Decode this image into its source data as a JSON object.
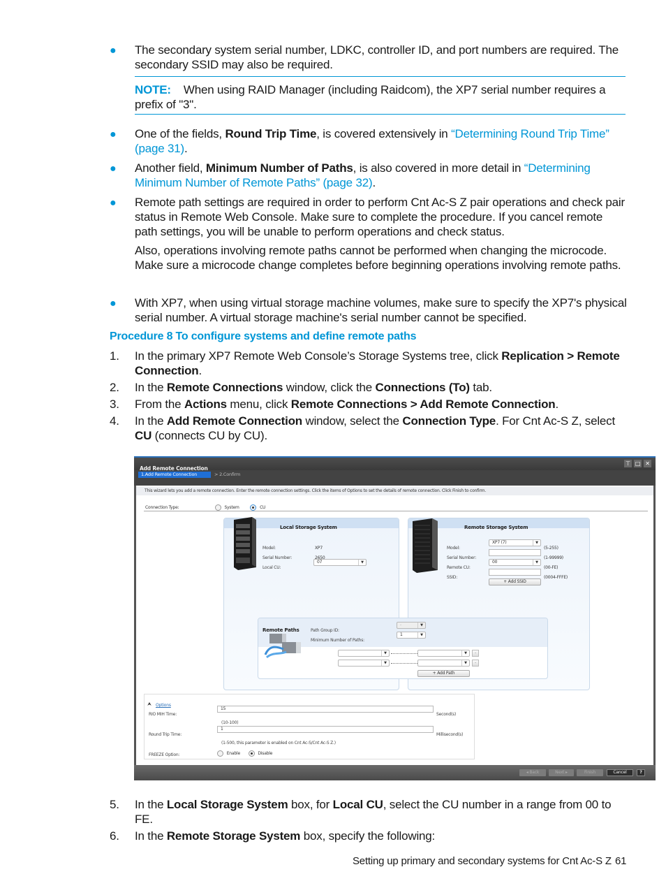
{
  "bullets": {
    "b1": {
      "text": "The secondary system serial number, LDKC, controller ID, and port numbers are required. The secondary SSID may also be required."
    },
    "note": {
      "label": "NOTE:",
      "text": "When using RAID Manager (including Raidcom), the XP7 serial number requires a prefix of \"3\"."
    },
    "b2": {
      "pre": "One of the fields, ",
      "bold": "Round Trip Time",
      "mid": ", is covered extensively in ",
      "link": "“Determining Round Trip Time” (page 31)",
      "post": "."
    },
    "b3": {
      "pre": "Another field, ",
      "bold": "Minimum Number of Paths",
      "mid": ", is also covered in more detail in ",
      "link": "“Determining Minimum Number of Remote Paths” (page 32)",
      "post": "."
    },
    "b4": {
      "text": "Remote path settings are required in order to perform Cnt Ac-S Z pair operations and check pair status in Remote Web Console. Make sure to complete the procedure. If you cancel remote path settings, you will be unable to perform operations and check status.",
      "text2": "Also, operations involving remote paths cannot be performed when changing the microcode. Make sure a microcode change completes before beginning operations involving remote paths."
    },
    "b5": {
      "text": "With XP7, when using virtual storage machine volumes, make sure to specify the XP7's physical serial number. A virtual storage machine's serial number cannot be specified."
    }
  },
  "procedure": {
    "title": "Procedure 8 To configure systems and define remote paths",
    "steps": [
      {
        "num": "1.",
        "parts": [
          "In the primary XP7 Remote Web Console’s Storage Systems tree, click ",
          "Replication > Remote Connection",
          "."
        ]
      },
      {
        "num": "2.",
        "parts": [
          "In the ",
          "Remote Connections",
          " window, click the ",
          "Connections (To)",
          " tab."
        ]
      },
      {
        "num": "3.",
        "parts": [
          "From the ",
          "Actions",
          " menu, click ",
          "Remote Connections > Add Remote Connection",
          "."
        ]
      },
      {
        "num": "4.",
        "parts": [
          "In the ",
          "Add Remote Connection",
          " window, select the ",
          "Connection Type",
          ". For Cnt Ac-S Z, select ",
          "CU",
          " (connects CU by CU)."
        ]
      },
      {
        "num": "5.",
        "parts": [
          "In the ",
          "Local Storage System",
          " box, for ",
          "Local CU",
          ", select the CU number in a range from 00 to FE."
        ]
      },
      {
        "num": "6.",
        "parts": [
          "In the ",
          "Remote Storage System",
          " box, specify the following:"
        ]
      }
    ]
  },
  "dialog": {
    "title": "Add Remote Connection",
    "window_buttons": [
      "pin-icon",
      "maximize-icon",
      "close-icon"
    ],
    "steps": {
      "active": "1.Add Remote Connection",
      "next": "> 2.Confirm"
    },
    "info": "This wizard lets you add a remote connection. Enter the remote connection settings. Click the items of Options to set the details of remote connection. Click Finish to confirm.",
    "connection_type": {
      "label": "Connection Type:",
      "options": [
        "System",
        "CU"
      ],
      "selected": "CU"
    },
    "local": {
      "title": "Local Storage System",
      "model_label": "Model:",
      "model": "XP7",
      "serial_label": "Serial Number:",
      "serial": "2650",
      "cu_label": "Local CU:",
      "cu": "07"
    },
    "remote": {
      "title": "Remote Storage System",
      "model_label": "Model:",
      "model": "XP7 (7)",
      "model_range": "(5-255)",
      "serial_label": "Serial Number:",
      "serial": "",
      "serial_range": "(1-99999)",
      "cu_label": "Remote CU:",
      "cu": "00",
      "cu_range": "(00-FE)",
      "ssid_label": "SSID:",
      "ssid": "",
      "ssid_range": "(0004-FFFE)",
      "add_ssid": "+ Add SSID"
    },
    "paths": {
      "title": "Remote Paths",
      "group_label": "Path Group ID:",
      "group": "-",
      "min_label": "Minimum Number of Paths:",
      "min": "1",
      "remove": "-",
      "add_path": "+ Add Path"
    },
    "options": {
      "link": "Options",
      "rio_label": "RIO MIH Time:",
      "rio": "15",
      "rio_range": "(10-100)",
      "rio_unit": "Second(s)",
      "rtt_label": "Round Trip Time:",
      "rtt": "1",
      "rtt_range": "(1-500, this parameter is enabled on Cnt Ac-S/Cnt Ac-S Z.)",
      "rtt_unit": "Millisecond(s)",
      "freeze_label": "FREEZE Option:",
      "freeze_options": [
        "Enable",
        "Disable"
      ],
      "freeze_selected": "Disable"
    },
    "footer": {
      "back": "◂ Back",
      "next": "Next ▸",
      "finish": "Finish",
      "cancel": "Cancel",
      "help": "?"
    }
  },
  "footer": {
    "text": "Setting up primary and secondary systems for Cnt Ac-S Z",
    "page": "61"
  }
}
